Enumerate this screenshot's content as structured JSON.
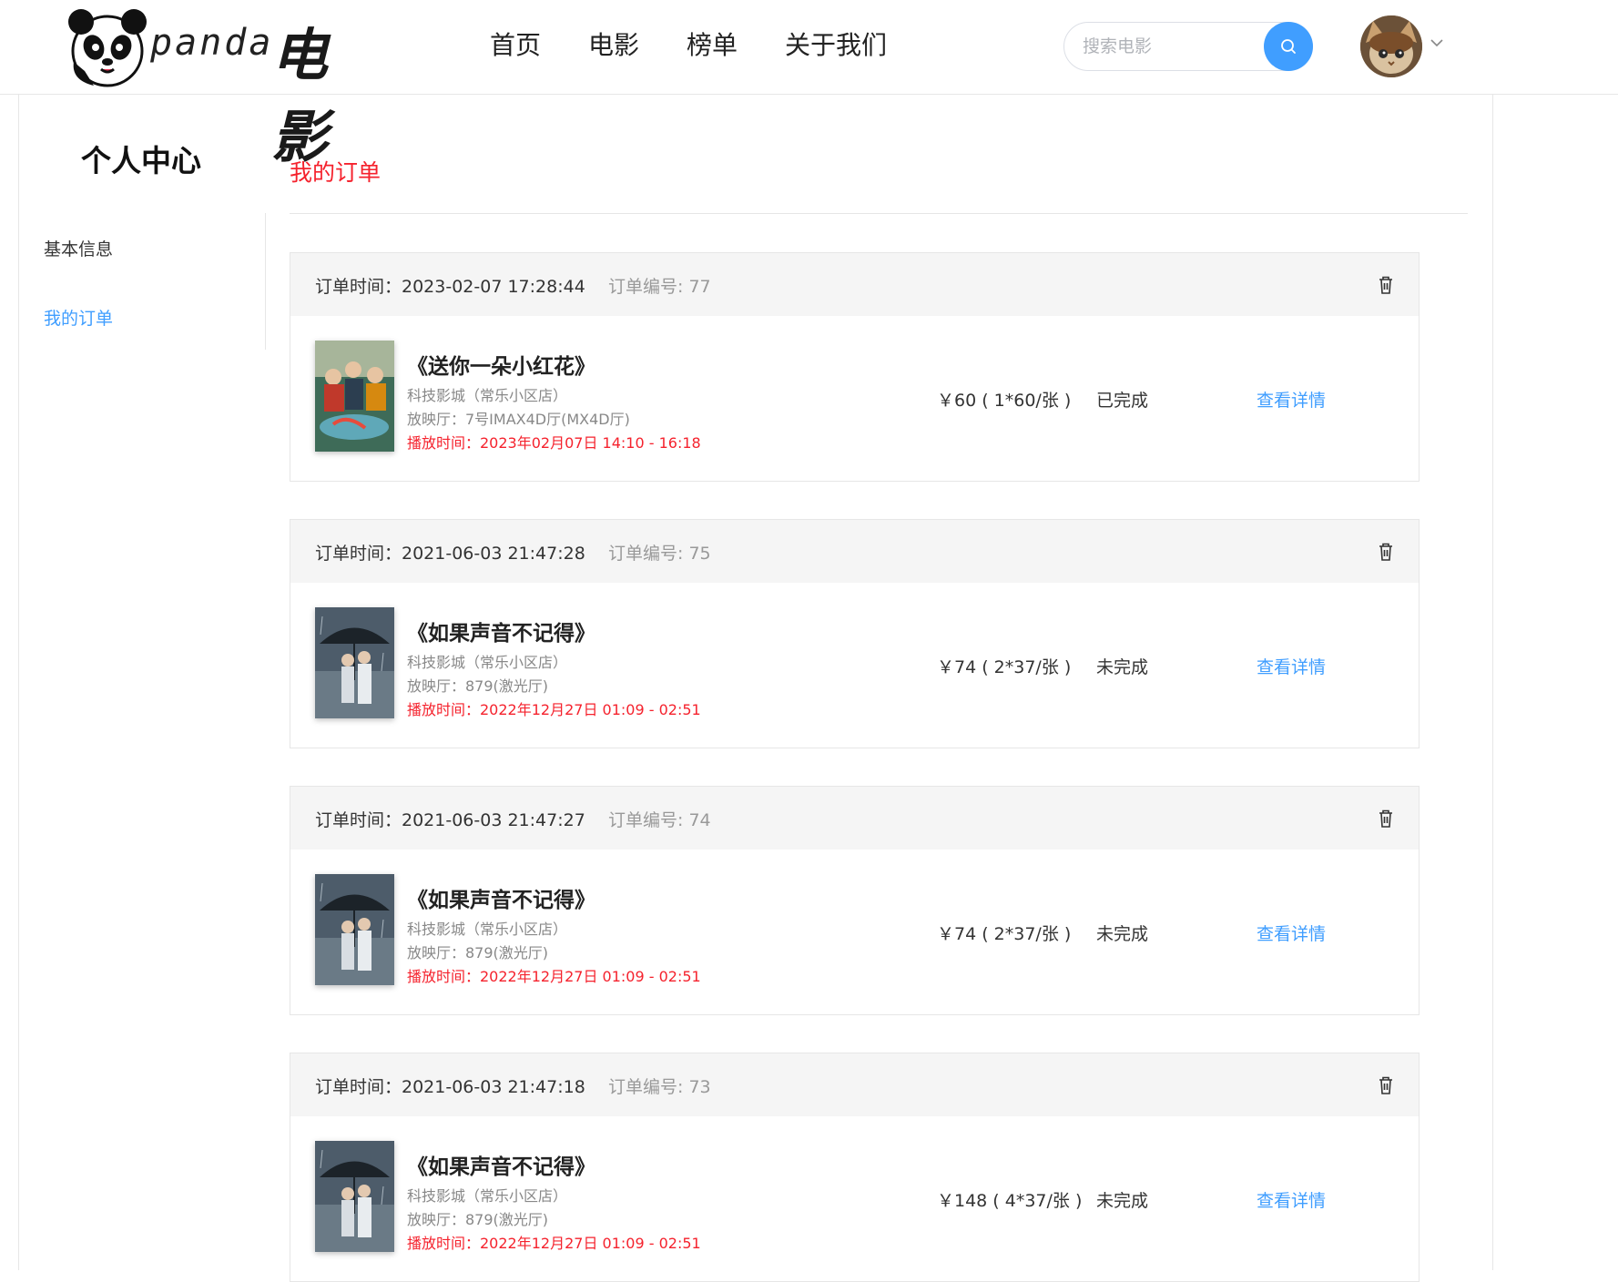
{
  "header": {
    "logo_text": "panda",
    "logo_cn": "电影",
    "nav": [
      "首页",
      "电影",
      "榜单",
      "关于我们"
    ],
    "search_placeholder": "搜索电影"
  },
  "sidebar": {
    "title": "个人中心",
    "items": [
      {
        "label": "基本信息"
      },
      {
        "label": "我的订单"
      }
    ]
  },
  "content": {
    "title": "我的订单"
  },
  "orders": [
    {
      "time_label": "订单时间：2023-02-07 17:28:44",
      "no_label": "订单编号: 77",
      "movie": "《送你一朵小红花》",
      "cinema": "科技影城（常乐小区店）",
      "hall": "放映厅：7号IMAX4D厅(MX4D厅)",
      "showtime": "播放时间：2023年02月07日 14:10 - 16:18",
      "price": "￥60 ( 1*60/张 )",
      "status": "已完成",
      "detail": "查看详情"
    },
    {
      "time_label": "订单时间：2021-06-03 21:47:28",
      "no_label": "订单编号: 75",
      "movie": "《如果声音不记得》",
      "cinema": "科技影城（常乐小区店）",
      "hall": "放映厅：879(激光厅)",
      "showtime": "播放时间：2022年12月27日 01:09 - 02:51",
      "price": "￥74 ( 2*37/张 )",
      "status": "未完成",
      "detail": "查看详情"
    },
    {
      "time_label": "订单时间：2021-06-03 21:47:27",
      "no_label": "订单编号: 74",
      "movie": "《如果声音不记得》",
      "cinema": "科技影城（常乐小区店）",
      "hall": "放映厅：879(激光厅)",
      "showtime": "播放时间：2022年12月27日 01:09 - 02:51",
      "price": "￥74 ( 2*37/张 )",
      "status": "未完成",
      "detail": "查看详情"
    },
    {
      "time_label": "订单时间：2021-06-03 21:47:18",
      "no_label": "订单编号: 73",
      "movie": "《如果声音不记得》",
      "cinema": "科技影城（常乐小区店）",
      "hall": "放映厅：879(激光厅)",
      "showtime": "播放时间：2022年12月27日 01:09 - 02:51",
      "price": "￥148 ( 4*37/张 )",
      "status": "未完成",
      "detail": "查看详情"
    }
  ],
  "colors": {
    "accent_blue": "#409eff",
    "accent_red": "#f5222d"
  }
}
